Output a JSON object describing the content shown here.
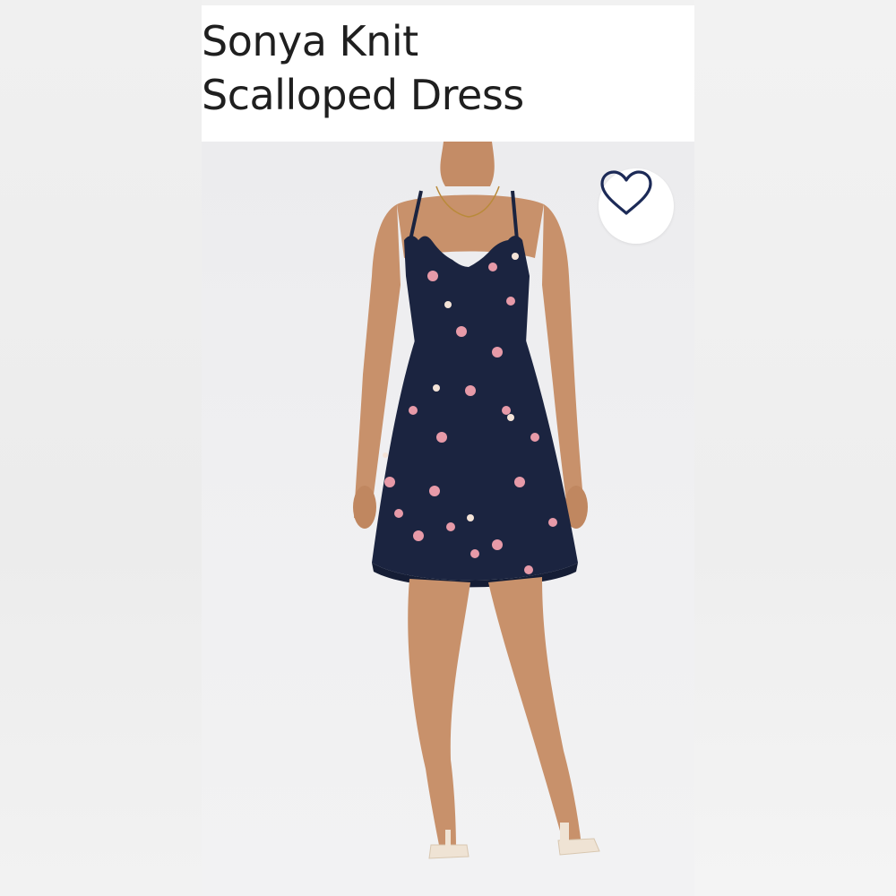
{
  "product": {
    "title_line1": "Sonya Knit",
    "title_line2": "Scalloped Dress"
  },
  "wishlist": {
    "icon": "heart-outline-icon",
    "icon_color": "#1c2a57"
  },
  "colors": {
    "dress_navy": "#1b2440",
    "floral_pink": "#e79aa8",
    "skin": "#c8916b"
  }
}
